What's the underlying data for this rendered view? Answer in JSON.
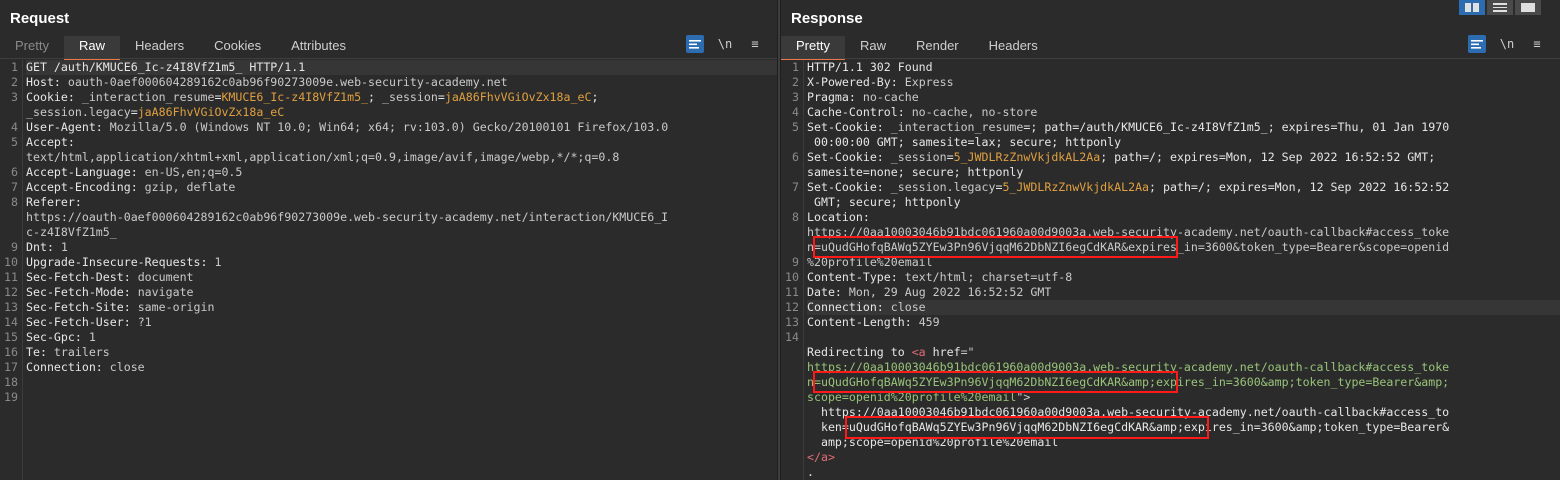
{
  "request": {
    "title": "Request",
    "tabs": [
      "Pretty",
      "Raw",
      "Headers",
      "Cookies",
      "Attributes"
    ],
    "line_numbers": [
      "1",
      "2",
      "3",
      "",
      "4",
      "5",
      "",
      "6",
      "7",
      "8",
      "",
      "",
      "9",
      "10",
      "11",
      "12",
      "13",
      "14",
      "15",
      "16",
      "17",
      "18",
      "19"
    ],
    "lines": [
      [
        {
          "t": "GET /auth/KMUCE6_Ic-z4I8VfZ1m5_ HTTP/1.1",
          "c": "k"
        }
      ],
      [
        {
          "t": "Host: ",
          "c": "k"
        },
        {
          "t": "oauth-0aef000604289162c0ab96f90273009e.web-security-academy.net",
          "c": "v"
        }
      ],
      [
        {
          "t": "Cookie: ",
          "c": "k"
        },
        {
          "t": "_interaction_resume",
          "c": "v"
        },
        {
          "t": "=",
          "c": "k"
        },
        {
          "t": "KMUCE6_Ic-z4I8VfZ1m5_",
          "c": "c"
        },
        {
          "t": "; ",
          "c": "k"
        },
        {
          "t": "_session",
          "c": "v"
        },
        {
          "t": "=",
          "c": "k"
        },
        {
          "t": "jaA86FhvVGiOvZx18a_eC",
          "c": "c"
        },
        {
          "t": ";",
          "c": "k"
        }
      ],
      [
        {
          "t": "_session.legacy",
          "c": "v"
        },
        {
          "t": "=",
          "c": "k"
        },
        {
          "t": "jaA86FhvVGiOvZx18a_eC",
          "c": "c"
        }
      ],
      [
        {
          "t": "User-Agent: ",
          "c": "k"
        },
        {
          "t": "Mozilla/5.0 (Windows NT 10.0; Win64; x64; rv:103.0) Gecko/20100101 Firefox/103.0",
          "c": "v"
        }
      ],
      [
        {
          "t": "Accept:",
          "c": "k"
        }
      ],
      [
        {
          "t": "text/html,application/xhtml+xml,application/xml;q=0.9,image/avif,image/webp,*/*;q=0.8",
          "c": "v"
        }
      ],
      [
        {
          "t": "Accept-Language: ",
          "c": "k"
        },
        {
          "t": "en-US,en;q=0.5",
          "c": "v"
        }
      ],
      [
        {
          "t": "Accept-Encoding: ",
          "c": "k"
        },
        {
          "t": "gzip, deflate",
          "c": "v"
        }
      ],
      [
        {
          "t": "Referer:",
          "c": "k"
        }
      ],
      [
        {
          "t": "https://oauth-0aef000604289162c0ab96f90273009e.web-security-academy.net/interaction/KMUCE6_I",
          "c": "v"
        }
      ],
      [
        {
          "t": "c-z4I8VfZ1m5_",
          "c": "v"
        }
      ],
      [
        {
          "t": "Dnt: ",
          "c": "k"
        },
        {
          "t": "1",
          "c": "v"
        }
      ],
      [
        {
          "t": "Upgrade-Insecure-Requests: ",
          "c": "k"
        },
        {
          "t": "1",
          "c": "v"
        }
      ],
      [
        {
          "t": "Sec-Fetch-Dest: ",
          "c": "k"
        },
        {
          "t": "document",
          "c": "v"
        }
      ],
      [
        {
          "t": "Sec-Fetch-Mode: ",
          "c": "k"
        },
        {
          "t": "navigate",
          "c": "v"
        }
      ],
      [
        {
          "t": "Sec-Fetch-Site: ",
          "c": "k"
        },
        {
          "t": "same-origin",
          "c": "v"
        }
      ],
      [
        {
          "t": "Sec-Fetch-User: ",
          "c": "k"
        },
        {
          "t": "?1",
          "c": "v"
        }
      ],
      [
        {
          "t": "Sec-Gpc: ",
          "c": "k"
        },
        {
          "t": "1",
          "c": "v"
        }
      ],
      [
        {
          "t": "Te: ",
          "c": "k"
        },
        {
          "t": "trailers",
          "c": "v"
        }
      ],
      [
        {
          "t": "Connection: ",
          "c": "k"
        },
        {
          "t": "close",
          "c": "v"
        }
      ],
      [],
      []
    ]
  },
  "response": {
    "title": "Response",
    "tabs": [
      "Pretty",
      "Raw",
      "Render",
      "Headers"
    ],
    "line_numbers": [
      "1",
      "2",
      "3",
      "4",
      "5",
      "",
      "6",
      "",
      "7",
      "",
      "8",
      "",
      "",
      "9",
      "10",
      "11",
      "12",
      "13",
      "14",
      "",
      "",
      "",
      "",
      "",
      "",
      "",
      "",
      ""
    ],
    "lines": [
      [
        {
          "t": "HTTP/1.1 302 Found",
          "c": "k"
        }
      ],
      [
        {
          "t": "X-Powered-By: ",
          "c": "k"
        },
        {
          "t": "Express",
          "c": "v"
        }
      ],
      [
        {
          "t": "Pragma: ",
          "c": "k"
        },
        {
          "t": "no-cache",
          "c": "v"
        }
      ],
      [
        {
          "t": "Cache-Control: ",
          "c": "k"
        },
        {
          "t": "no-cache, no-store",
          "c": "v"
        }
      ],
      [
        {
          "t": "Set-Cookie: ",
          "c": "k"
        },
        {
          "t": "_interaction_resume",
          "c": "v"
        },
        {
          "t": "=; path=/auth/KMUCE6_Ic-z4I8VfZ1m5_; expires=Thu, 01 Jan 1970",
          "c": "k"
        }
      ],
      [
        {
          "t": " 00:00:00 GMT; samesite=lax; secure; httponly",
          "c": "k"
        }
      ],
      [
        {
          "t": "Set-Cookie: ",
          "c": "k"
        },
        {
          "t": "_session",
          "c": "v"
        },
        {
          "t": "=",
          "c": "k"
        },
        {
          "t": "5_JWDLRzZnwVkjdkAL2Aa",
          "c": "c"
        },
        {
          "t": "; path=/; expires=Mon, 12 Sep 2022 16:52:52 GMT;",
          "c": "k"
        }
      ],
      [
        {
          "t": "samesite=none; secure; httponly",
          "c": "k"
        }
      ],
      [
        {
          "t": "Set-Cookie: ",
          "c": "k"
        },
        {
          "t": "_session.legacy",
          "c": "v"
        },
        {
          "t": "=",
          "c": "k"
        },
        {
          "t": "5_JWDLRzZnwVkjdkAL2Aa",
          "c": "c"
        },
        {
          "t": "; path=/; expires=Mon, 12 Sep 2022 16:52:52",
          "c": "k"
        }
      ],
      [
        {
          "t": " GMT; secure; httponly",
          "c": "k"
        }
      ],
      [
        {
          "t": "Location:",
          "c": "k"
        }
      ],
      [
        {
          "t": "https://0aa10003046b91bdc061960a00d9003a.web-security-academy.net/oauth-callback#access_toke",
          "c": "v"
        }
      ],
      [
        {
          "t": "n=uQudGHofqBAWq5ZYEw3Pn96VjqqM62DbNZI6egCdKAR&expires_in=3600&token_type=Bearer&scope=openid",
          "c": "v"
        }
      ],
      [
        {
          "t": "%20profile%20email",
          "c": "v"
        }
      ],
      [
        {
          "t": "Content-Type: ",
          "c": "k"
        },
        {
          "t": "text/html; charset=utf-8",
          "c": "v"
        }
      ],
      [
        {
          "t": "Date: ",
          "c": "k"
        },
        {
          "t": "Mon, 29 Aug 2022 16:52:52 GMT",
          "c": "v"
        }
      ],
      [
        {
          "t": "Connection: ",
          "c": "k"
        },
        {
          "t": "close",
          "c": "v"
        }
      ],
      [
        {
          "t": "Content-Length: ",
          "c": "k"
        },
        {
          "t": "459",
          "c": "v"
        }
      ],
      [],
      [
        {
          "t": "Redirecting to ",
          "c": "k"
        },
        {
          "t": "<a ",
          "c": "t"
        },
        {
          "t": "href",
          "c": "k"
        },
        {
          "t": "=\"",
          "c": "v"
        }
      ],
      [
        {
          "t": "https://0aa10003046b91bdc061960a00d9003a.web-security-academy.net/oauth-callback#access_toke",
          "c": "g"
        }
      ],
      [
        {
          "t": "n=uQudGHofqBAWq5ZYEw3Pn96VjqqM62DbNZI6egCdKAR&amp;expires_in=3600&amp;token_type=Bearer&amp;",
          "c": "g"
        }
      ],
      [
        {
          "t": "scope=openid%20profile%20email",
          "c": "g"
        },
        {
          "t": "\">",
          "c": "v"
        }
      ],
      [
        {
          "t": "  https://0aa10003046b91bdc061960a00d9003a.web-security-academy.net/oauth-callback#access_to",
          "c": "k"
        }
      ],
      [
        {
          "t": "  ken=uQudGHofqBAWq5ZYEw3Pn96VjqqM62DbNZI6egCdKAR&amp;expires_in=3600&amp;token_type=Bearer&",
          "c": "k"
        }
      ],
      [
        {
          "t": "  amp;scope=openid%20profile%20email",
          "c": "k"
        }
      ],
      [
        {
          "t": "</a>",
          "c": "t"
        }
      ],
      [
        {
          "t": ".",
          "c": "k"
        }
      ]
    ]
  },
  "toolbar": {
    "wrap_label": "\\n",
    "menu_label": "≡",
    "pretty_icon": "pretty-print-icon"
  }
}
